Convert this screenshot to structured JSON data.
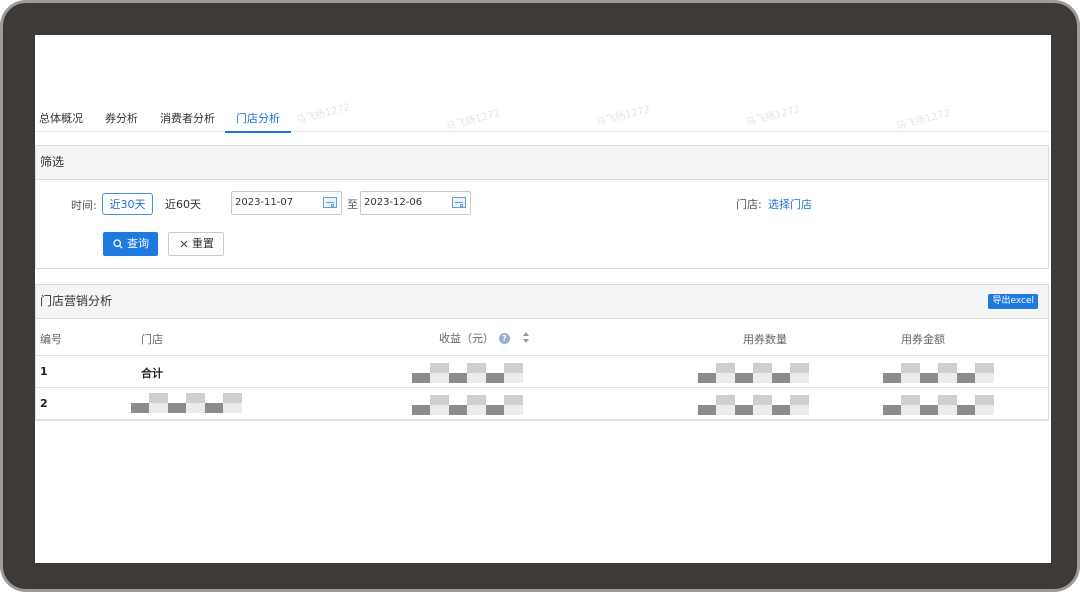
{
  "tabs": [
    {
      "label": "总体概况"
    },
    {
      "label": "券分析"
    },
    {
      "label": "消费者分析"
    },
    {
      "label": "门店分析"
    }
  ],
  "filter": {
    "title": "筛选",
    "time_label": "时间:",
    "range_30": "近30天",
    "range_60": "近60天",
    "start_date": "2023-11-07",
    "to_label": "至",
    "end_date": "2023-12-06",
    "store_label": "门店:",
    "store_link": "选择门店",
    "query_button": "查询",
    "reset_button": "重置"
  },
  "marketing": {
    "title": "门店营销分析",
    "export_button": "导出excel",
    "columns": [
      "编号",
      "门店",
      "收益（元）",
      "用券数量",
      "用券金额"
    ],
    "rows": [
      {
        "id": "1",
        "store": "合计"
      },
      {
        "id": "2",
        "store": ""
      }
    ]
  },
  "watermark": "马飞扬1272",
  "colors": {
    "accent": "#1f7ae0",
    "frame": "#3d3a38"
  }
}
